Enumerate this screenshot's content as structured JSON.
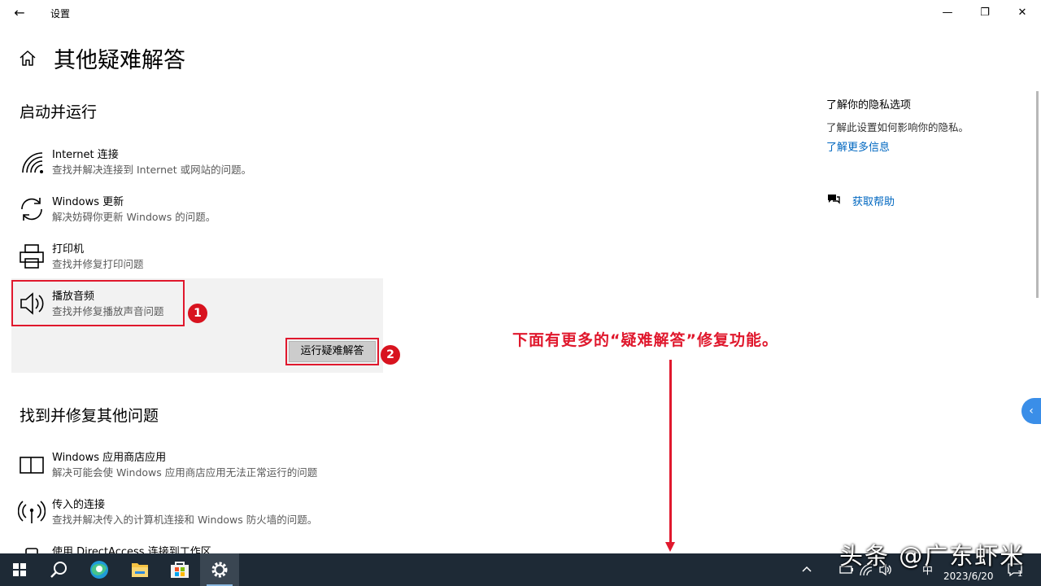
{
  "window": {
    "app_title": "设置",
    "back_glyph": "←",
    "minimize_glyph": "—",
    "maximize_glyph": "❐",
    "close_glyph": "✕"
  },
  "page": {
    "title": "其他疑难解答"
  },
  "sections": {
    "startup_title": "启动并运行",
    "other_title": "找到并修复其他问题"
  },
  "startup_items": [
    {
      "icon": "wifi-icon",
      "name": "Internet 连接",
      "desc": "查找并解决连接到 Internet 或网站的问题。"
    },
    {
      "icon": "refresh-icon",
      "name": "Windows 更新",
      "desc": "解决妨碍你更新 Windows 的问题。"
    },
    {
      "icon": "printer-icon",
      "name": "打印机",
      "desc": "查找并修复打印问题"
    },
    {
      "icon": "speaker-icon",
      "name": "播放音频",
      "desc": "查找并修复播放声音问题"
    }
  ],
  "run_button_label": "运行疑难解答",
  "badges": {
    "one": "1",
    "two": "2"
  },
  "other_items": [
    {
      "icon": "store-app-icon",
      "name": "Windows 应用商店应用",
      "desc": "解决可能会使 Windows 应用商店应用无法正常运行的问题"
    },
    {
      "icon": "antenna-icon",
      "name": "传入的连接",
      "desc": "查找并解决传入的计算机连接和 Windows 防火墙的问题。"
    },
    {
      "icon": "phone-icon",
      "name": "使用 DirectAccess 连接到工作区",
      "desc": ""
    }
  ],
  "annotation": "下面有更多的“疑难解答”修复功能。",
  "right_panel": {
    "privacy_title": "了解你的隐私选项",
    "privacy_desc": "了解此设置如何影响你的隐私。",
    "learn_more": "了解更多信息",
    "get_help": "获取帮助"
  },
  "side_tab_glyph": "‹",
  "taskbar": {
    "tray_ime": "中",
    "date": "2023/6/20",
    "notification_count": "1"
  },
  "watermark": "头条 @广东虾米",
  "colors": {
    "accent_link": "#0067c0",
    "annotation_red": "#e0182d",
    "taskbar_bg": "#1e2a36"
  }
}
